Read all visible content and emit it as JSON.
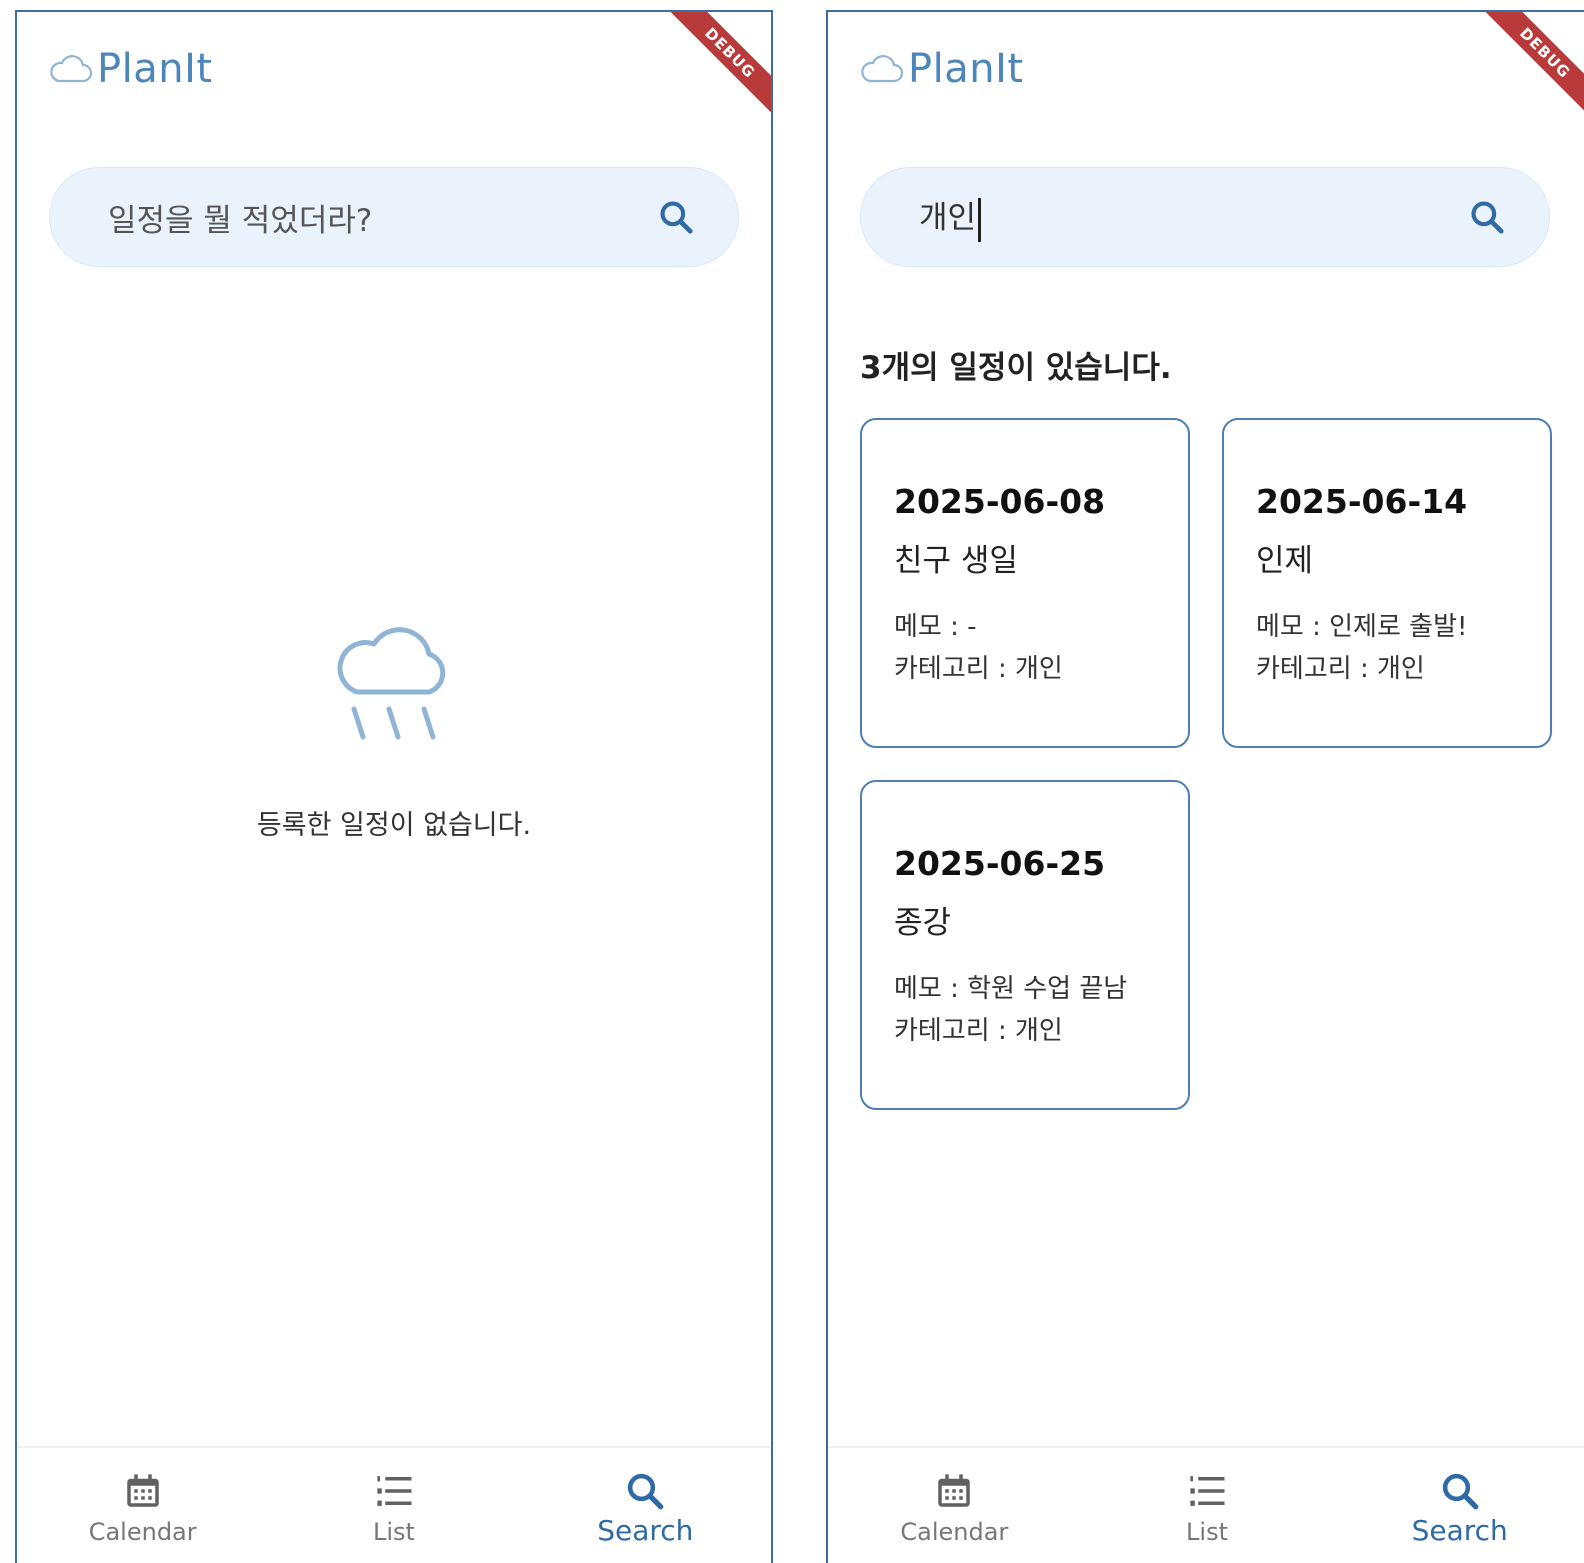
{
  "app": {
    "logo_text": "PlanIt",
    "debug_label": "DEBUG"
  },
  "left": {
    "search": {
      "placeholder": "일정을 뭘 적었더라?"
    },
    "empty_state": {
      "icon": "rain-cloud-icon",
      "message": "등록한 일정이 없습니다."
    }
  },
  "right": {
    "search": {
      "value": "개인"
    },
    "result_count": "3개의 일정이 있습니다.",
    "cards": [
      {
        "date": "2025-06-08",
        "title": "친구 생일",
        "memo": "메모 : -",
        "category": "카테고리 : 개인"
      },
      {
        "date": "2025-06-14",
        "title": "인제",
        "memo": "메모 : 인제로 출발!",
        "category": "카테고리 : 개인"
      },
      {
        "date": "2025-06-25",
        "title": "종강",
        "memo": "메모 : 학원 수업 끝남",
        "category": "카테고리 : 개인"
      }
    ]
  },
  "nav": {
    "items": [
      {
        "label": "Calendar",
        "icon": "calendar-icon",
        "active": false
      },
      {
        "label": "List",
        "icon": "list-icon",
        "active": false
      },
      {
        "label": "Search",
        "icon": "search-icon",
        "active": true
      }
    ]
  },
  "colors": {
    "accent": "#2f6aa6",
    "logo": "#4d86bb",
    "search_bg": "#eaf3fb",
    "card_border": "#4d7fb5",
    "debug": "#b83a3a"
  }
}
